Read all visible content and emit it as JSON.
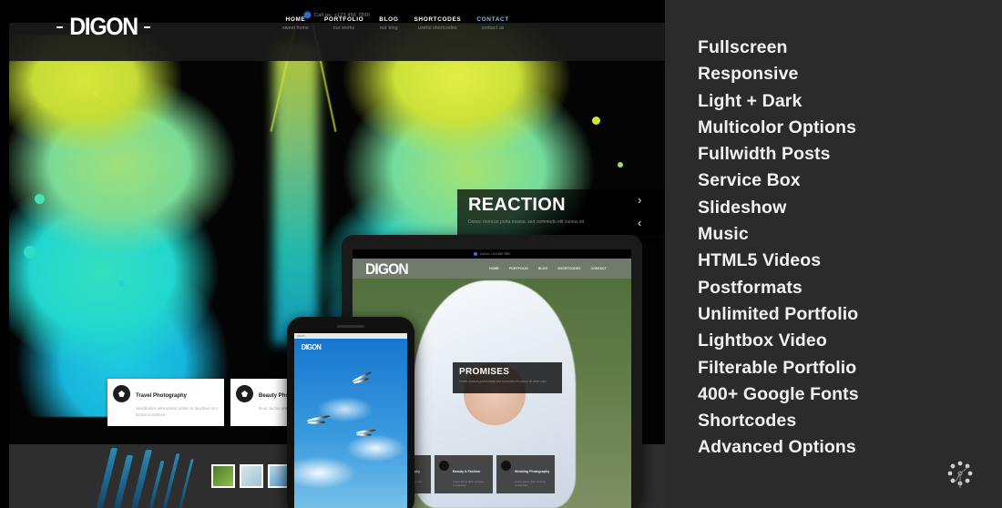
{
  "panel": {
    "background_color": "#2b2b2b",
    "text_color": "#f1f1f1",
    "features": [
      "Fullscreen",
      "Responsive",
      "Light + Dark",
      "Multicolor Options",
      "Fullwidth Posts",
      "Service Box",
      "Slideshow",
      "Music",
      "HTML5 Videos",
      "Postformats",
      "Unlimited Portfolio",
      "Lightbox Video",
      "Filterable Portfolio",
      "400+ Google Fonts",
      "Shortcodes",
      "Advanced Options"
    ],
    "logo_mark": "radial-burst-icon"
  },
  "preview": {
    "topbar": {
      "phone_icon": "phone-icon",
      "call_text": "Call us: +123 456 7890"
    },
    "brand": "DIGON",
    "nav": [
      {
        "label": "HOME",
        "sub": "sweet home",
        "active": false
      },
      {
        "label": "PORTFOLIO",
        "sub": "our works",
        "active": false
      },
      {
        "label": "BLOG",
        "sub": "our blog",
        "active": false
      },
      {
        "label": "SHORTCODES",
        "sub": "useful shortcodes",
        "active": false
      },
      {
        "label": "CONTACT",
        "sub": "contact us",
        "active": true
      }
    ],
    "slide": {
      "title": "REACTION",
      "subtitle": "Donec rhoncus porta massa, sed commodo elit cursus sit",
      "next_icon": "chevron-right-icon",
      "prev_icon": "chevron-left-icon"
    },
    "services": [
      {
        "title": "Travel Photography",
        "text": "Vestibulum ante ipsum primis in faucibus orci luctus ut ultrices"
      },
      {
        "title": "Beauty Photography",
        "text": "Nunc luctus ante ipsum primis faucibus"
      }
    ],
    "thumbnails": [
      "thumb-1",
      "thumb-2",
      "thumb-3"
    ]
  },
  "tablet": {
    "topbar_call": "Call us: +123 456 7890",
    "brand": "DIGON",
    "nav": [
      "HOME",
      "PORTFOLIO",
      "BLOG",
      "SHORTCODES",
      "CONTACT"
    ],
    "caption_title": "PROMISES",
    "caption_sub": "Donec rhoncus porta massa sed commodo elit cursus sit amet nunc",
    "services": [
      {
        "title": "Hotel Photography",
        "text": "Lorem ipsum dolor sit amet consectetur"
      },
      {
        "title": "Beauty & Fashion",
        "text": "Lorem ipsum dolor sit amet consectetur"
      },
      {
        "title": "Wedding Photography",
        "text": "Lorem ipsum dolor sit amet consectetur"
      }
    ]
  },
  "phone": {
    "statusbar": "DIGON",
    "brand": "DIGON"
  }
}
